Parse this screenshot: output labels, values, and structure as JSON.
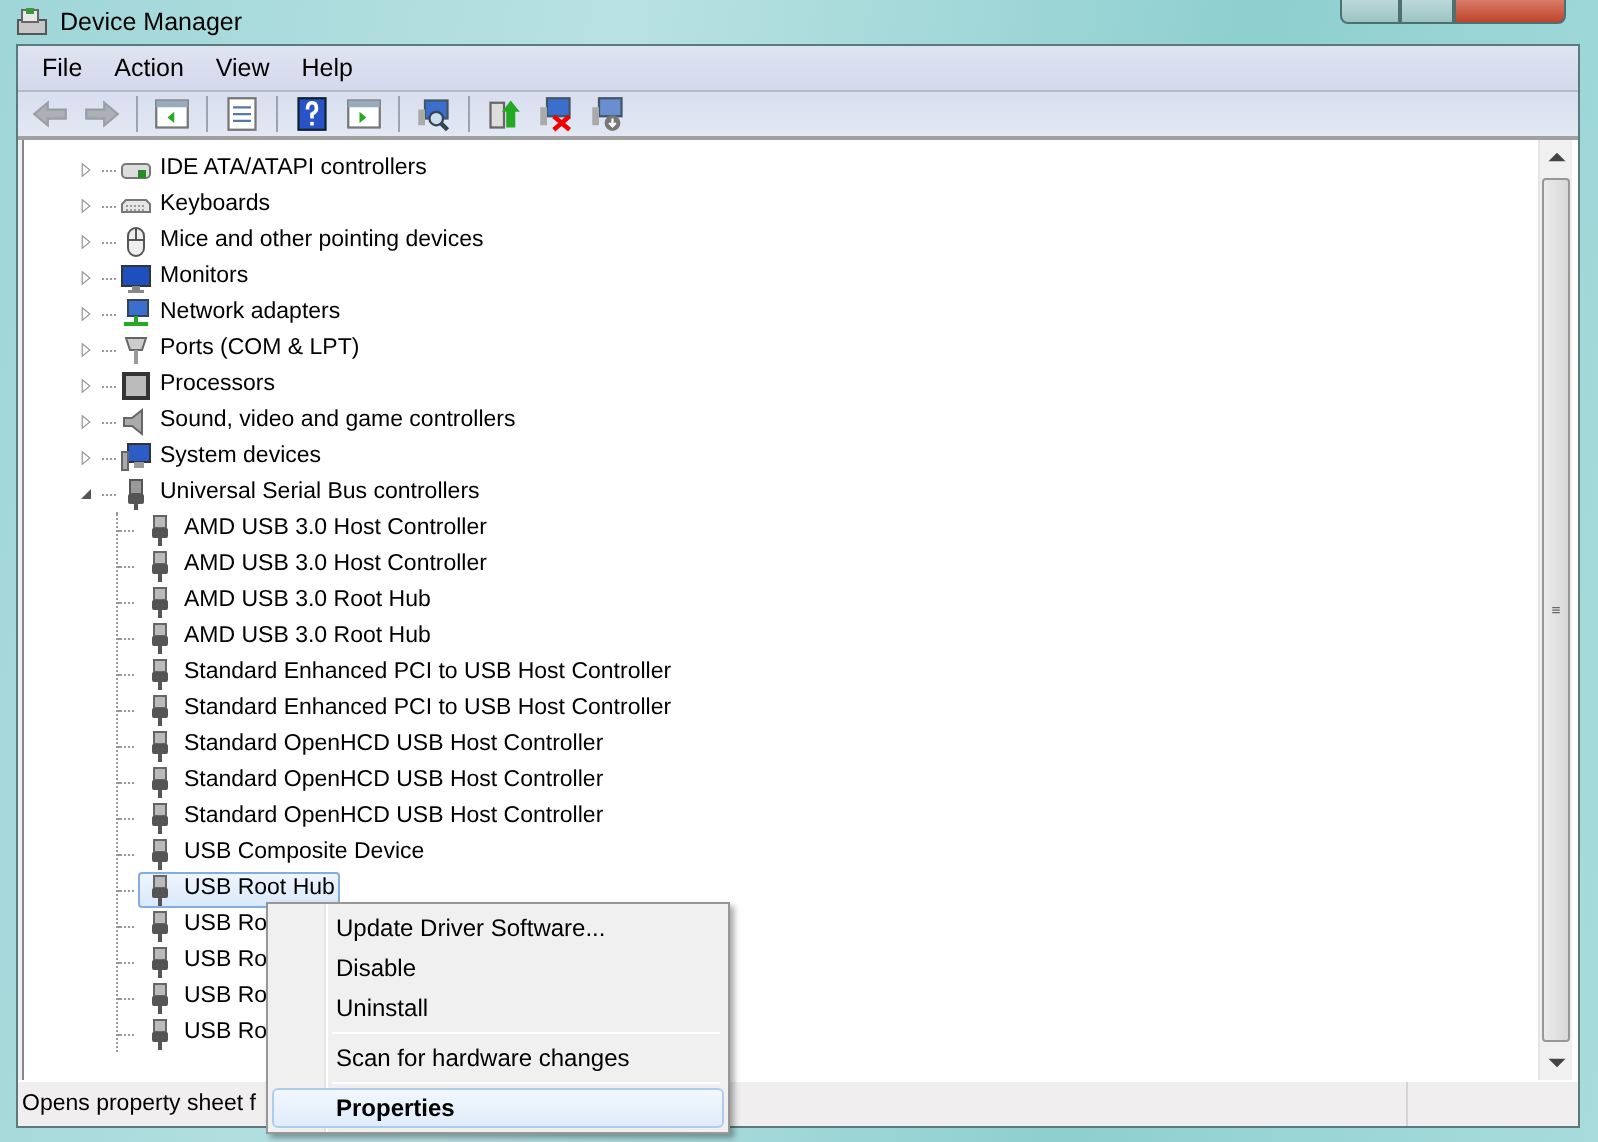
{
  "window": {
    "title": "Device Manager"
  },
  "menu": [
    "File",
    "Action",
    "View",
    "Help"
  ],
  "toolbar": [
    {
      "disabled": true
    },
    {
      "disabled": true
    },
    {
      "disabled": false
    },
    {
      "disabled": false
    },
    {
      "disabled": false
    },
    {
      "disabled": false
    },
    {
      "disabled": false
    },
    {
      "disabled": false
    },
    {
      "disabled": false
    },
    {
      "disabled": false
    }
  ],
  "tree": [
    {
      "label": "IDE ATA/ATAPI controllers",
      "expanded": false
    },
    {
      "label": "Keyboards",
      "expanded": false
    },
    {
      "label": "Mice and other pointing devices",
      "expanded": false
    },
    {
      "label": "Monitors",
      "expanded": false
    },
    {
      "label": "Network adapters",
      "expanded": false
    },
    {
      "label": "Ports (COM & LPT)",
      "expanded": false
    },
    {
      "label": "Processors",
      "expanded": false
    },
    {
      "label": "Sound, video and game controllers",
      "expanded": false
    },
    {
      "label": "System devices",
      "expanded": false
    },
    {
      "label": "Universal Serial Bus controllers",
      "expanded": true,
      "children": [
        {
          "label": "AMD USB 3.0 Host Controller",
          "selected": false
        },
        {
          "label": "AMD USB 3.0 Host Controller",
          "selected": false
        },
        {
          "label": "AMD USB 3.0 Root Hub",
          "selected": false
        },
        {
          "label": "AMD USB 3.0 Root Hub",
          "selected": false
        },
        {
          "label": "Standard Enhanced PCI to USB Host Controller",
          "selected": false
        },
        {
          "label": "Standard Enhanced PCI to USB Host Controller",
          "selected": false
        },
        {
          "label": "Standard OpenHCD USB Host Controller",
          "selected": false
        },
        {
          "label": "Standard OpenHCD USB Host Controller",
          "selected": false
        },
        {
          "label": "Standard OpenHCD USB Host Controller",
          "selected": false
        },
        {
          "label": "USB Composite Device",
          "selected": false
        },
        {
          "label": "USB Root Hub",
          "selected": true
        },
        {
          "label": "USB Ro",
          "selected": false
        },
        {
          "label": "USB Ro",
          "selected": false
        },
        {
          "label": "USB Ro",
          "selected": false
        },
        {
          "label": "USB Ro",
          "selected": false
        }
      ]
    }
  ],
  "context_menu": [
    {
      "kind": "item",
      "label": "Update Driver Software...",
      "selected": false
    },
    {
      "kind": "item",
      "label": "Disable",
      "selected": false
    },
    {
      "kind": "item",
      "label": "Uninstall",
      "selected": false
    },
    {
      "kind": "separator"
    },
    {
      "kind": "item",
      "label": "Scan for hardware changes",
      "selected": false
    },
    {
      "kind": "separator"
    },
    {
      "kind": "item",
      "label": "Properties",
      "selected": true
    }
  ],
  "status_bar": {
    "text": "Opens property sheet f"
  }
}
